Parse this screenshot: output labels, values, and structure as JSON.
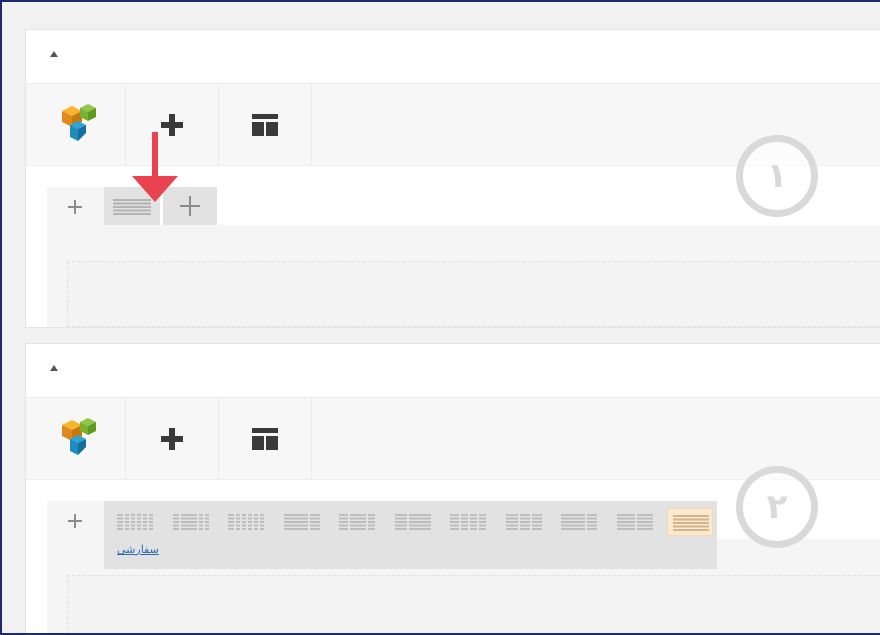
{
  "panels": [
    {
      "badge": "١",
      "toolbar": {
        "logo_icon": "composer-logo-icon",
        "add_icon": "plus-icon",
        "template_icon": "template-icon"
      }
    },
    {
      "badge": "٢",
      "toolbar": {
        "logo_icon": "composer-logo-icon",
        "add_icon": "plus-icon",
        "template_icon": "template-icon"
      },
      "layout_options": [
        {
          "name": "layout-1-6x6",
          "active": false
        },
        {
          "name": "layout-1-6-4-6",
          "active": false
        },
        {
          "name": "layout-1-6x6-alt",
          "active": false
        },
        {
          "name": "layout-2-3-1-3",
          "active": false
        },
        {
          "name": "layout-1-4-1-2-1-4",
          "active": false
        },
        {
          "name": "layout-1-3-2-3",
          "active": false
        },
        {
          "name": "layout-1-4x4",
          "active": false
        },
        {
          "name": "layout-1-3x3",
          "active": false
        },
        {
          "name": "layout-2-3-1-3-alt",
          "active": false
        },
        {
          "name": "layout-1-2x2",
          "active": false
        },
        {
          "name": "layout-1-1",
          "active": true
        }
      ],
      "custom_label": "سفارشی"
    }
  ],
  "colors": {
    "accent_arrow": "#e8434f",
    "active_layout": "#fbe9cf",
    "badge": "#d9d9d9",
    "frame": "#1f2a6b"
  }
}
